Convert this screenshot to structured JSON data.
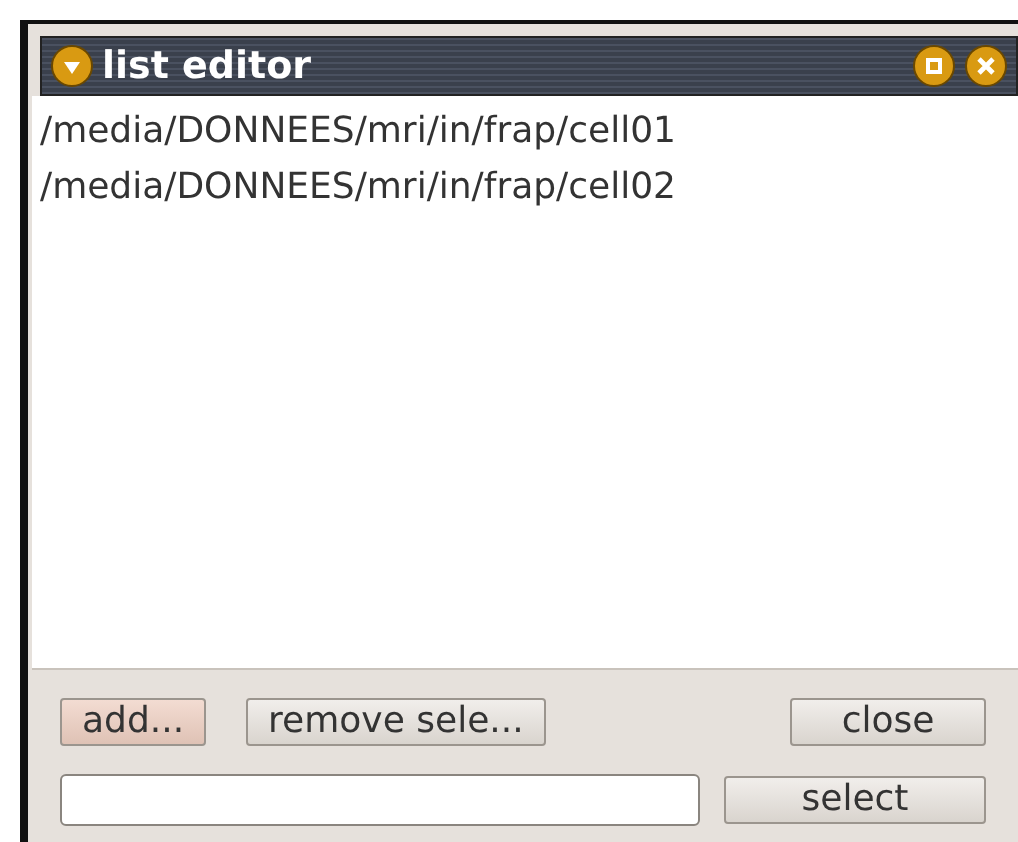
{
  "window": {
    "title": "list editor"
  },
  "list": {
    "items": [
      {
        "text": "/media/DONNEES/mri/in/frap/cell01"
      },
      {
        "text": "/media/DONNEES/mri/in/frap/cell02"
      }
    ]
  },
  "buttons": [
    {
      "label": "add...",
      "focused": true
    },
    {
      "label": "remove sele...",
      "focused": false
    },
    {
      "label": "close",
      "focused": false
    }
  ],
  "select_button": {
    "label": "select"
  }
}
